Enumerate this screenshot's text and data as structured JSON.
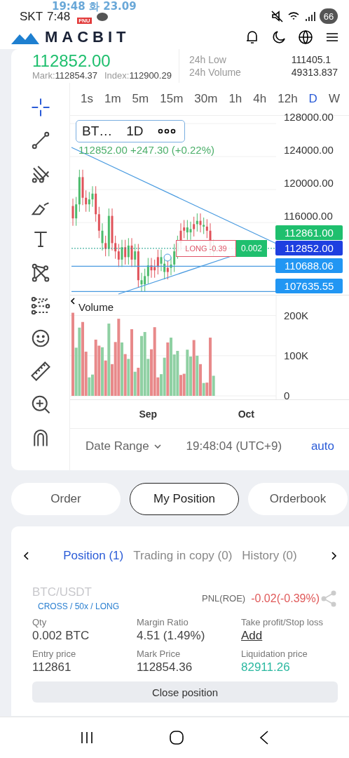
{
  "status_bar": {
    "overlay_clock": "19:48 화 23.09",
    "carrier": "SKT",
    "time": "7:48",
    "badge": "FNU",
    "battery": "66"
  },
  "header": {
    "logo": "MACBIT"
  },
  "ticker": {
    "price": "112852.00",
    "mark_label": "Mark:",
    "mark": "112854.37",
    "index_label": "Index:",
    "index": "112900.29",
    "stats": [
      {
        "label": "24h Low",
        "value": "111405.1"
      },
      {
        "label": "24h Volume",
        "value": "49313.837"
      }
    ]
  },
  "chart": {
    "intervals": [
      {
        "label": "1s",
        "selected": false
      },
      {
        "label": "1m",
        "selected": false
      },
      {
        "label": "5m",
        "selected": false
      },
      {
        "label": "15m",
        "selected": false
      },
      {
        "label": "30m",
        "selected": false
      },
      {
        "label": "1h",
        "selected": false
      },
      {
        "label": "4h",
        "selected": false
      },
      {
        "label": "12h",
        "selected": false
      },
      {
        "label": "D",
        "selected": true
      },
      {
        "label": "W",
        "selected": false
      }
    ],
    "tools": [
      {
        "kind": "crosshair",
        "selected": true
      },
      {
        "kind": "line",
        "selected": false
      },
      {
        "kind": "pitchfork",
        "selected": false
      },
      {
        "kind": "brush",
        "selected": false
      },
      {
        "kind": "text",
        "selected": false
      },
      {
        "kind": "pattern",
        "selected": false
      },
      {
        "kind": "fib",
        "selected": false
      },
      {
        "kind": "emoji",
        "selected": false
      },
      {
        "kind": "ruler",
        "selected": false
      },
      {
        "kind": "zoom",
        "selected": false
      },
      {
        "kind": "magnet",
        "selected": false
      }
    ],
    "legend": {
      "symbol": "BT…",
      "interval": "1D",
      "values": "112852.00 +247.30 (+0.22%)"
    },
    "price_axis": [
      "128000.00",
      "124000.00",
      "120000.00",
      "116000.00"
    ],
    "price_tags": [
      {
        "value": "112861.00",
        "color": "#1fbf6e"
      },
      {
        "value": "112852.00",
        "color": "#1e3fe0"
      },
      {
        "value": "110688.06",
        "color": "#2196f3"
      },
      {
        "value": "107635.55",
        "color": "#2196f3"
      }
    ],
    "position_marker": {
      "label": "LONG -0.39",
      "qty": "0.002"
    },
    "volume": {
      "title": "Volume",
      "chart_data": {
        "type": "bar",
        "stacked": true,
        "categories": [
          null,
          null,
          null,
          null,
          null,
          null,
          null,
          null,
          null,
          null,
          null,
          null,
          null,
          null,
          null,
          null,
          null,
          null,
          null,
          null,
          null,
          null,
          null,
          "Sep",
          null,
          null,
          null,
          null,
          null,
          null,
          null,
          null,
          null,
          null,
          null,
          null,
          null,
          null,
          null,
          null,
          null,
          null,
          null,
          null,
          null,
          null,
          null,
          null,
          null,
          null,
          null,
          null,
          null,
          "Oct"
        ],
        "ylim": [
          0,
          250000
        ],
        "yticks": [
          0,
          {
            "value": 100000,
            "label": "100K"
          },
          {
            "value": 200000,
            "label": "200K"
          }
        ],
        "series": [
          {
            "color": "#8fd0a3",
            "values": [
              null,
              120000,
              170000,
              null,
              null,
              46000,
              53000,
              null,
              null,
              121000,
              null,
              180000,
              null,
              null,
              null,
              133000,
              null,
              92000,
              null,
              60000,
              null,
              149000,
              159000,
              92000,
              null,
              null,
              null,
              54000,
              95000,
              null,
              145000,
              103000,
              112000,
              null,
              null,
              115000,
              98000,
              null,
              100000,
              null,
              32000,
              null,
              null,
              50000,
              null,
              null,
              null,
              null,
              null,
              null,
              null,
              null,
              null,
              null
            ]
          },
          {
            "color": "#e8898a",
            "values": [
              207000,
              null,
              null,
              184000,
              110000,
              null,
              null,
              140000,
              125000,
              null,
              88000,
              null,
              79000,
              134000,
              192000,
              null,
              104000,
              null,
              166000,
              null,
              70000,
              null,
              null,
              null,
              116000,
              171000,
              46000,
              null,
              null,
              133000,
              null,
              null,
              null,
              52000,
              55000,
              null,
              null,
              139000,
              null,
              79000,
              null,
              33000,
              145000,
              null,
              null,
              null,
              null,
              null,
              null,
              null,
              null,
              null,
              null,
              null
            ]
          }
        ]
      }
    },
    "footer": {
      "date_range": "Date Range",
      "time": "19:48:04 (UTC+9)",
      "scale": "auto"
    }
  },
  "section_tabs": [
    {
      "label": "Order",
      "selected": false
    },
    {
      "label": "My Position",
      "selected": true
    },
    {
      "label": "Orderbook",
      "selected": false
    }
  ],
  "position_panel": {
    "tabs": [
      {
        "label": "Position (1)",
        "selected": true
      },
      {
        "label": "Trading in copy (0)",
        "selected": false
      },
      {
        "label": "History (0)",
        "selected": false
      }
    ],
    "symbol": "BTC/USDT",
    "mode": "CROSS / 50x / LONG",
    "pnl_label": "PNL(ROE)",
    "pnl": "-0.02(-0.39%)",
    "fields": [
      {
        "label": "Qty",
        "value": "0.002 BTC",
        "kind": "text"
      },
      {
        "label": "Margin Ratio",
        "value": "4.51 (1.49%)",
        "kind": "text"
      },
      {
        "label": "Take profit/Stop loss",
        "value": "Add",
        "kind": "link"
      },
      {
        "label": "Entry price",
        "value": "112861",
        "kind": "text"
      },
      {
        "label": "Mark Price",
        "value": "112854.36",
        "kind": "text"
      },
      {
        "label": "Liquidation price",
        "value": "82911.26",
        "kind": "highlight"
      }
    ],
    "close_button": "Close position"
  }
}
